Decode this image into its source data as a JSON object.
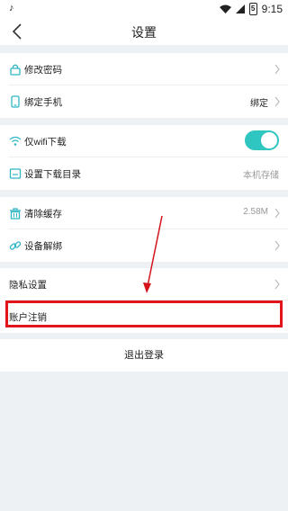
{
  "status_bar": {
    "left_icon": "tiktok-icon",
    "time": "9:15",
    "battery": "5"
  },
  "nav": {
    "title": "设置",
    "back_icon": "back-chevron-icon"
  },
  "groups": [
    {
      "items": [
        {
          "icon": "lock-icon",
          "label": "修改密码",
          "value": "",
          "chevron": true
        },
        {
          "icon": "phone-icon",
          "label": "绑定手机",
          "value": "绑定",
          "chevron": true
        }
      ]
    },
    {
      "items": [
        {
          "icon": "wifi-icon",
          "label": "仅wifi下载",
          "toggle": true,
          "toggle_on": true
        },
        {
          "icon": "folder-icon",
          "label": "设置下载目录",
          "value": "本机存储",
          "chevron": false
        }
      ]
    },
    {
      "items": [
        {
          "icon": "trash-icon",
          "label": "清除缓存",
          "value": "2.58M",
          "chevron": true
        },
        {
          "icon": "link-icon",
          "label": "设备解绑",
          "value": "",
          "chevron": true
        }
      ]
    },
    {
      "items": [
        {
          "label": "隐私设置",
          "chevron": true
        },
        {
          "label": "账户注销",
          "chevron": false
        }
      ]
    }
  ],
  "logout_label": "退出登录",
  "colors": {
    "accent": "#2fc5c0",
    "highlight": "#e2141c",
    "background": "#eef1f4"
  }
}
